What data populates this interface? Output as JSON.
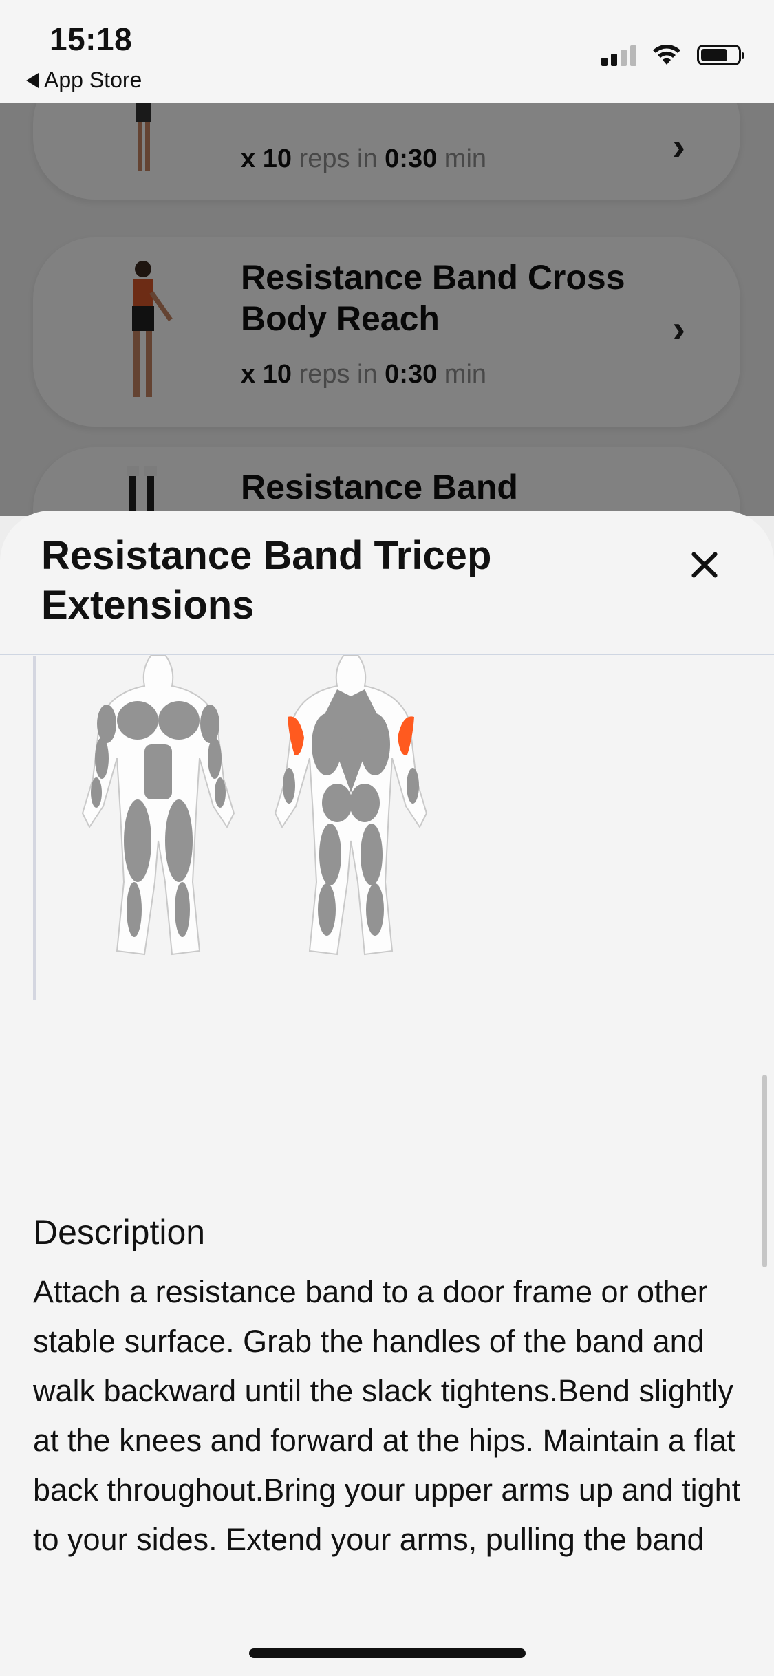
{
  "status_bar": {
    "time": "15:18",
    "back_label": "App Store"
  },
  "list": {
    "cards": [
      {
        "title": "",
        "reps": "10",
        "reps_word": "reps in",
        "time": "0:30",
        "time_unit": "min"
      },
      {
        "title": "Resistance Band Cross Body Reach",
        "reps": "10",
        "reps_word": "reps in",
        "time": "0:30",
        "time_unit": "min"
      },
      {
        "title": "Resistance Band"
      }
    ]
  },
  "sheet": {
    "title": "Resistance Band Tricep Extensions",
    "description_heading": "Description",
    "description": "Attach a resistance band to a door frame or other stable surface. Grab the handles of the band and walk backward until the slack tightens.Bend slightly at the knees and forward at the hips. Maintain a flat back throughout.Bring your upper arms up and tight to your sides. Extend your arms, pulling the band",
    "highlight_color": "#ff5a1f",
    "muscle_color": "#939393"
  }
}
